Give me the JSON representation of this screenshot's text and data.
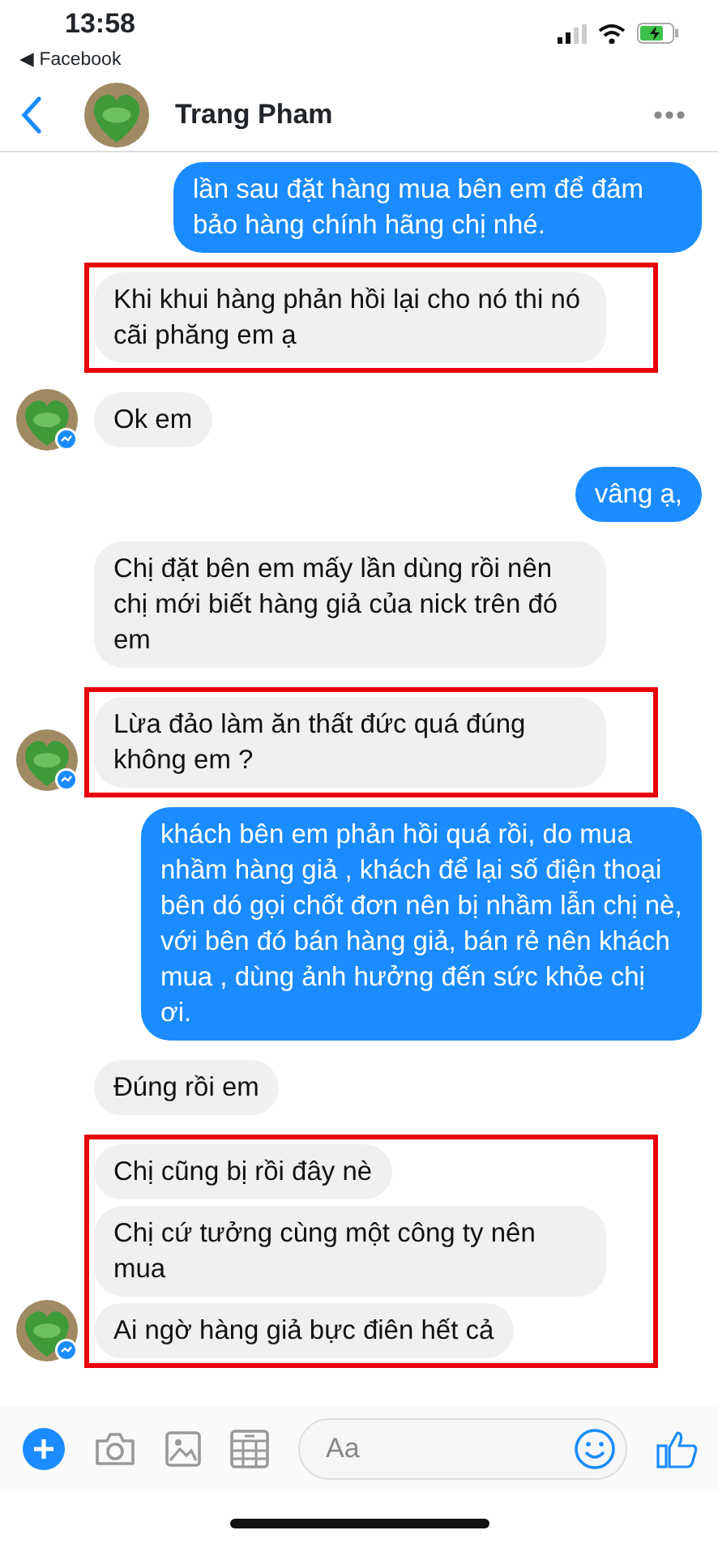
{
  "status_bar": {
    "time": "13:58",
    "back_app": "◀ Facebook"
  },
  "header": {
    "name": "Trang Pham"
  },
  "blocks": [
    {
      "kind": "sent",
      "highlighted": false,
      "messages": [
        "lần sau đặt hàng mua bên em để đảm bảo hàng chính hãng chị nhé."
      ]
    },
    {
      "kind": "received",
      "highlighted": true,
      "avatar": false,
      "messages": [
        "Khi khui hàng phản hồi lại cho nó thi nó cãi phăng em ạ"
      ]
    },
    {
      "kind": "received",
      "highlighted": false,
      "avatar": true,
      "messages": [
        "Ok em"
      ]
    },
    {
      "kind": "sent",
      "highlighted": false,
      "messages": [
        "vâng ạ,"
      ]
    },
    {
      "kind": "received",
      "highlighted": false,
      "avatar": false,
      "messages": [
        "Chị đặt bên em mấy lần dùng rồi nên chị mới biết hàng giả của nick trên đó em"
      ]
    },
    {
      "kind": "received",
      "highlighted": true,
      "avatar": true,
      "messages": [
        "Lừa đảo làm ăn thất đức quá đúng không em ?"
      ]
    },
    {
      "kind": "sent",
      "highlighted": false,
      "messages": [
        "khách bên em phản hồi quá rồi, do mua nhầm hàng giả , khách để lại số điện thoại bên dó gọi chốt đơn nên bị nhầm lẫn chị nè, với bên đó bán hàng giả, bán rẻ nên khách mua , dùng ảnh hưởng đến sức khỏe chị ơi."
      ]
    },
    {
      "kind": "received",
      "highlighted": false,
      "avatar": false,
      "messages": [
        "Đúng rồi em"
      ]
    },
    {
      "kind": "received",
      "highlighted": true,
      "avatar": true,
      "messages": [
        "Chị cũng bị rồi đây nè",
        "Chị cứ tưởng cùng một công ty nên mua",
        "Ai ngờ hàng giả bực điên hết cả"
      ]
    }
  ],
  "composer": {
    "placeholder": "Aa"
  }
}
